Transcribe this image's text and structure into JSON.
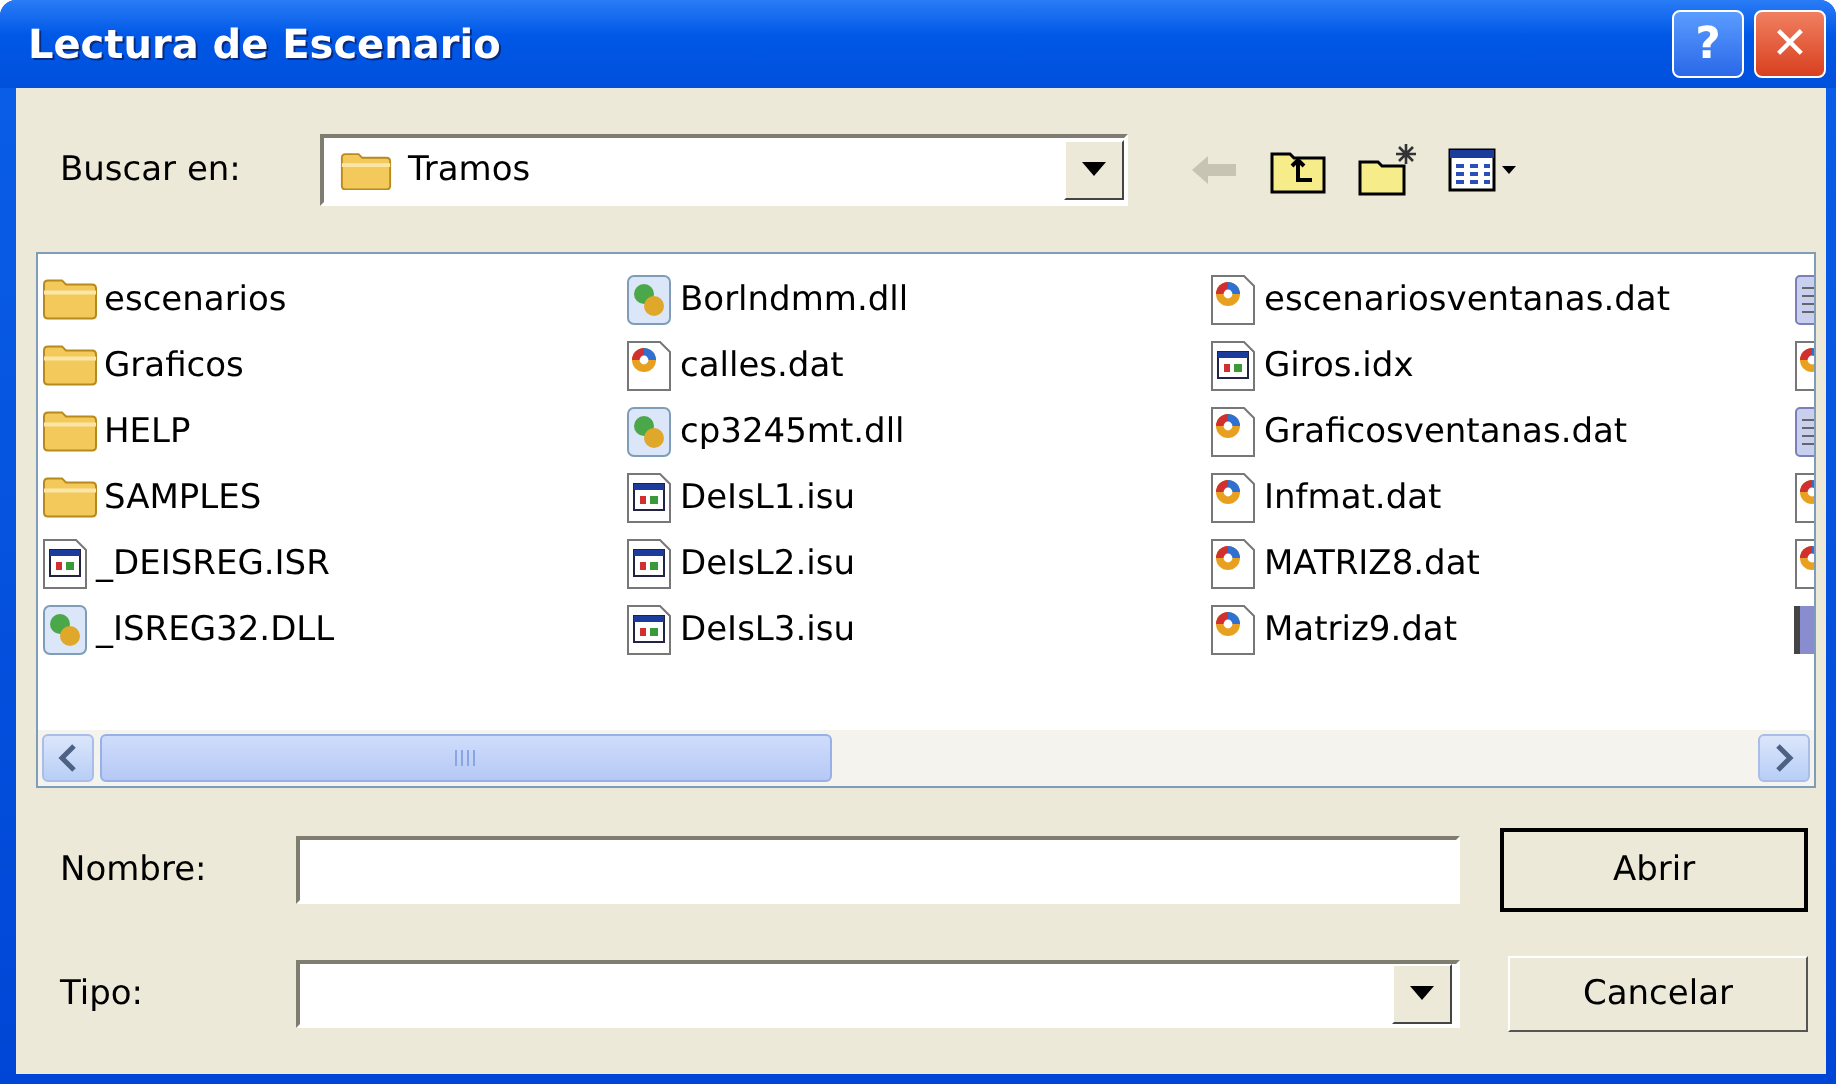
{
  "window": {
    "title": "Lectura de Escenario",
    "buttons": [
      {
        "kind": "help",
        "label": "?"
      },
      {
        "kind": "close",
        "label": "✕"
      }
    ]
  },
  "look_in": {
    "label": "Buscar en:",
    "value": "Tramos"
  },
  "toolbar": [
    {
      "kind": "back",
      "disabled": true
    },
    {
      "kind": "up",
      "disabled": false
    },
    {
      "kind": "new_folder",
      "disabled": false
    },
    {
      "kind": "views",
      "disabled": false
    }
  ],
  "files": [
    [
      {
        "kind": "folder",
        "name": "escenarios"
      },
      {
        "kind": "folder",
        "name": "Graficos"
      },
      {
        "kind": "folder",
        "name": "HELP"
      },
      {
        "kind": "folder",
        "name": "SAMPLES"
      },
      {
        "kind": "app",
        "name": "_DEISREG.ISR"
      },
      {
        "kind": "dll",
        "name": "_ISREG32.DLL"
      }
    ],
    [
      {
        "kind": "dll",
        "name": "Borlndmm.dll"
      },
      {
        "kind": "dat",
        "name": "calles.dat"
      },
      {
        "kind": "dll",
        "name": "cp3245mt.dll"
      },
      {
        "kind": "app",
        "name": "DeIsL1.isu"
      },
      {
        "kind": "app",
        "name": "DeIsL2.isu"
      },
      {
        "kind": "app",
        "name": "DeIsL3.isu"
      }
    ],
    [
      {
        "kind": "dat",
        "name": "escenariosventanas.dat"
      },
      {
        "kind": "app",
        "name": "Giros.idx"
      },
      {
        "kind": "dat",
        "name": "Graficosventanas.dat"
      },
      {
        "kind": "dat",
        "name": "Infmat.dat"
      },
      {
        "kind": "dat",
        "name": "MATRIZ8.dat"
      },
      {
        "kind": "dat",
        "name": "Matriz9.dat"
      }
    ],
    [
      {
        "kind": "text"
      },
      {
        "kind": "dat"
      },
      {
        "kind": "text"
      },
      {
        "kind": "dat"
      },
      {
        "kind": "dat"
      },
      {
        "kind": "partial"
      }
    ]
  ],
  "name_field": {
    "label": "Nombre:"
  },
  "type_field": {
    "label": "Tipo:"
  },
  "buttons": [
    {
      "label": "Abrir",
      "default": true
    },
    {
      "label": "Cancelar",
      "default": false
    }
  ]
}
